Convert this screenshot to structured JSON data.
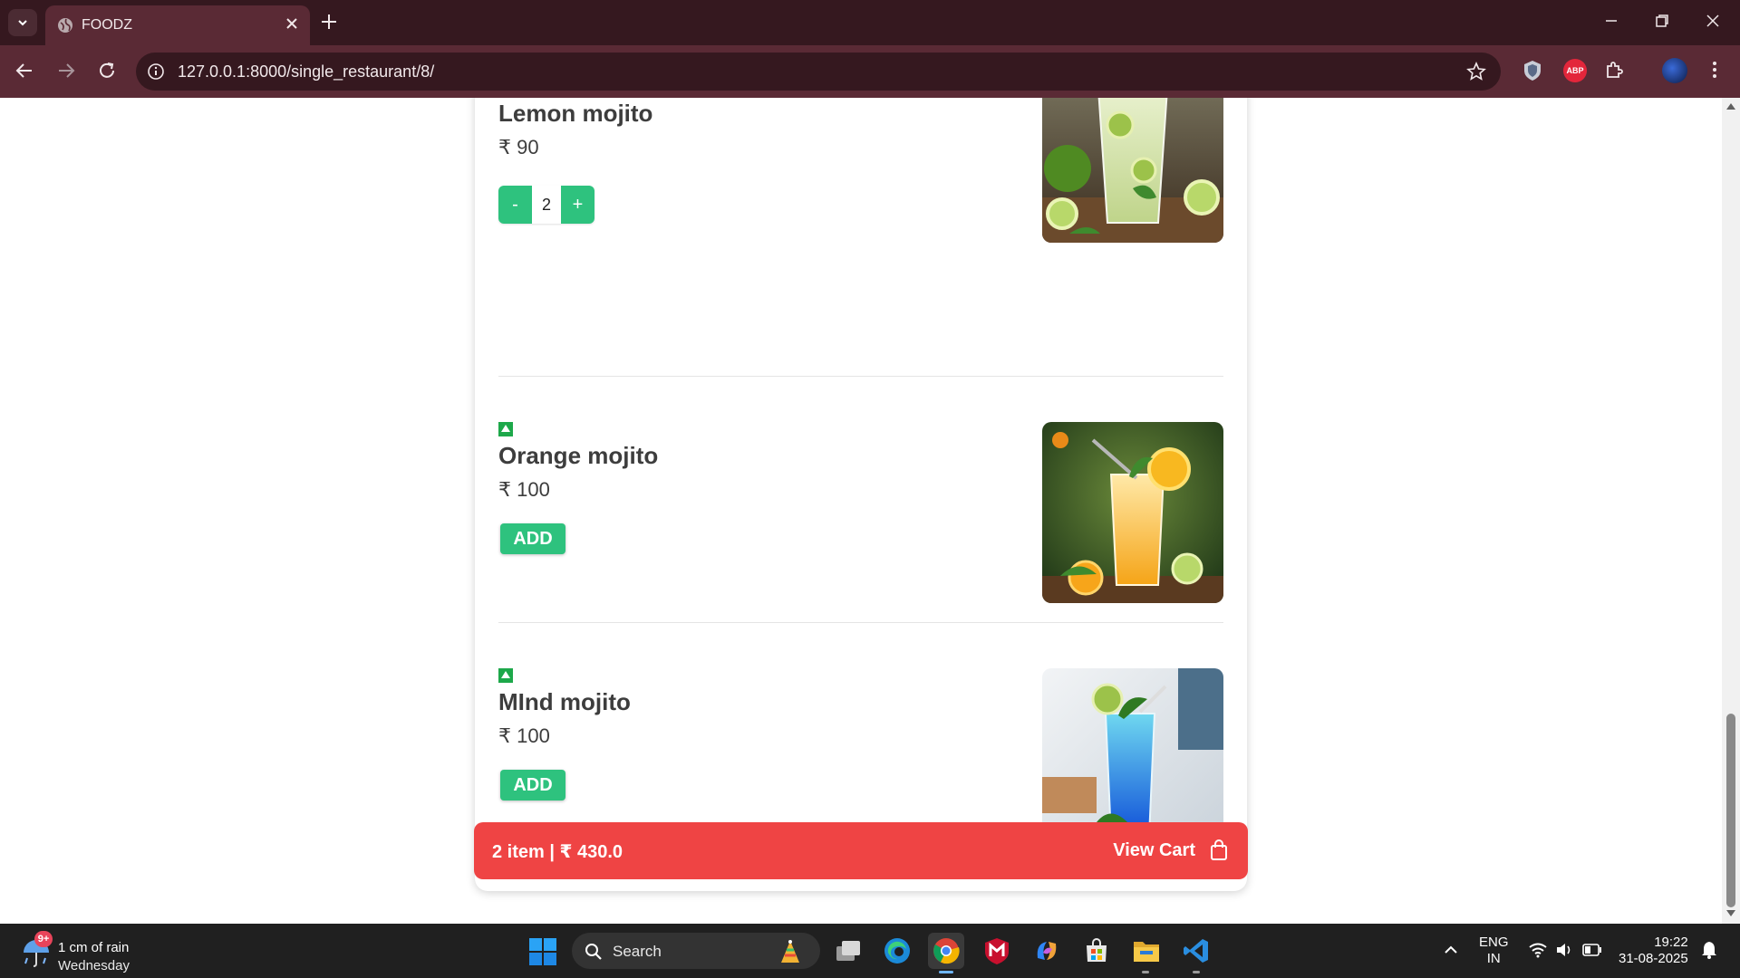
{
  "browser": {
    "tab_title": "FOODZ",
    "url": "127.0.0.1:8000/single_restaurant/8/"
  },
  "menu_items": [
    {
      "name": "Lemon mojito",
      "price": "₹ 90",
      "quantity": "2",
      "in_cart": true,
      "image_icon": "lemon-mojito-photo"
    },
    {
      "name": "Orange mojito",
      "price": "₹ 100",
      "add_label": "ADD",
      "in_cart": false,
      "image_icon": "orange-mojito-photo"
    },
    {
      "name": "MInd mojito",
      "price": "₹ 100",
      "add_label": "ADD",
      "in_cart": false,
      "image_icon": "blue-mojito-photo"
    }
  ],
  "stepper": {
    "minus": "-",
    "plus": "+"
  },
  "cart_bar": {
    "summary": "2 item | ₹ 430.0",
    "view_label": "View Cart",
    "color": "#ef4444"
  },
  "colors": {
    "accent_green": "#2ec27e",
    "veg_badge": "#1da84a"
  },
  "taskbar": {
    "weather_badge": "9+",
    "weather_line1": "1 cm of rain",
    "weather_line2": "Wednesday",
    "search_label": "Search",
    "lang_line1": "ENG",
    "lang_line2": "IN",
    "time": "19:22",
    "date": "31-08-2025"
  }
}
